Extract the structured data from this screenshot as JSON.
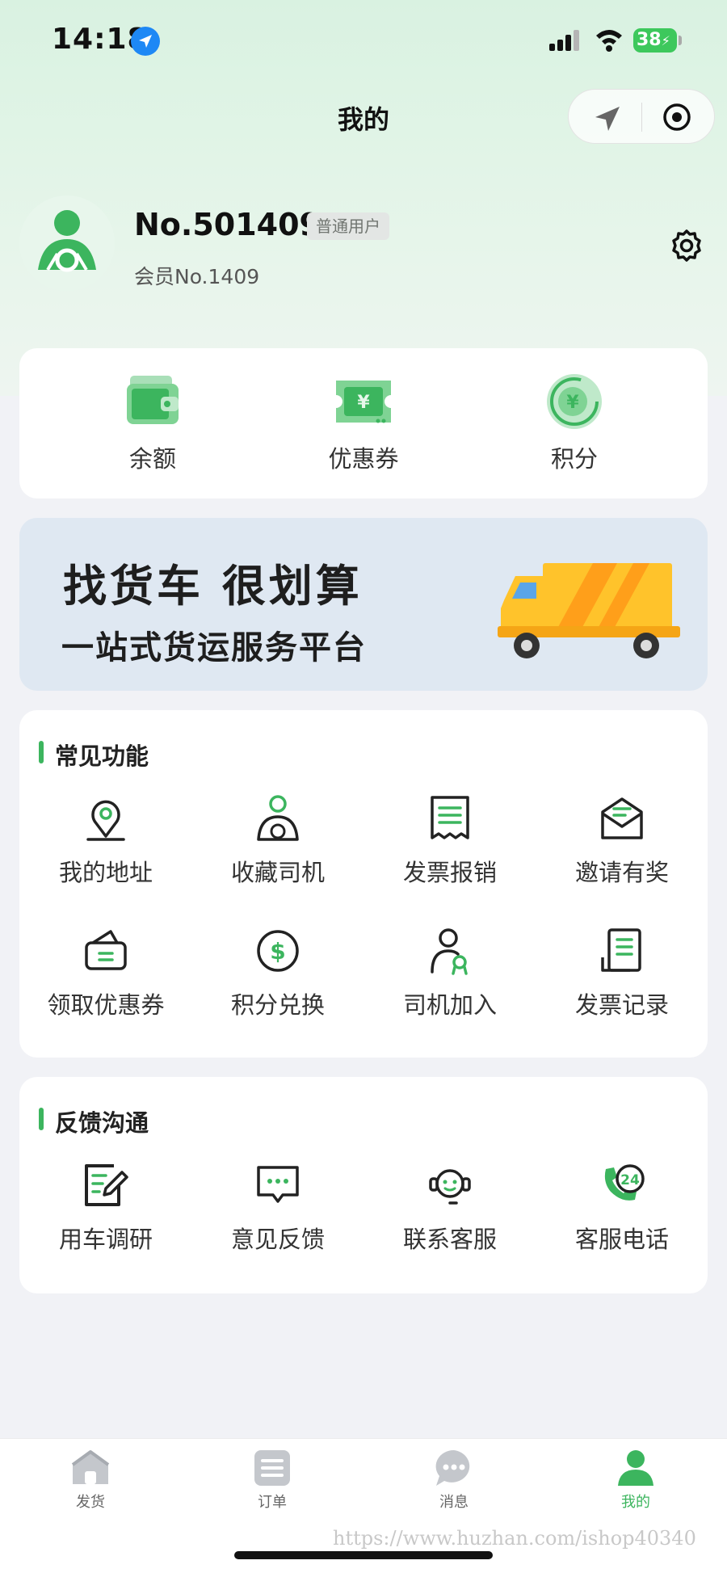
{
  "status_bar": {
    "time": "14:18",
    "battery": "38",
    "icons": [
      "location-arrow-icon",
      "signal-icon",
      "wifi-icon",
      "battery-icon"
    ]
  },
  "nav": {
    "title": "我的",
    "capsule_icons": [
      "navigation-arrow-icon",
      "target-icon"
    ]
  },
  "profile": {
    "name": "No.501409",
    "badge": "普通用户",
    "member_no": "会员No.1409",
    "settings_icon": "gear-icon"
  },
  "wallet": {
    "items": [
      {
        "label": "余额",
        "icon": "wallet-icon"
      },
      {
        "label": "优惠券",
        "icon": "coupon-icon"
      },
      {
        "label": "积分",
        "icon": "points-icon"
      }
    ]
  },
  "banner": {
    "title": "找货车 很划算",
    "subtitle": "一站式货运服务平台",
    "image": "truck-illustration"
  },
  "common": {
    "title": "常见功能",
    "items": [
      {
        "label": "我的地址",
        "icon": "address-pin-icon"
      },
      {
        "label": "收藏司机",
        "icon": "driver-icon"
      },
      {
        "label": "发票报销",
        "icon": "invoice-icon"
      },
      {
        "label": "邀请有奖",
        "icon": "invite-envelope-icon"
      },
      {
        "label": "领取优惠券",
        "icon": "coupon-wallet-icon"
      },
      {
        "label": "积分兑换",
        "icon": "dollar-coin-icon"
      },
      {
        "label": "司机加入",
        "icon": "driver-join-icon"
      },
      {
        "label": "发票记录",
        "icon": "invoice-record-icon"
      }
    ]
  },
  "feedback": {
    "title": "反馈沟通",
    "items": [
      {
        "label": "用车调研",
        "icon": "survey-edit-icon"
      },
      {
        "label": "意见反馈",
        "icon": "chat-bubble-icon"
      },
      {
        "label": "联系客服",
        "icon": "headset-icon"
      },
      {
        "label": "客服电话",
        "icon": "phone-24-icon"
      }
    ]
  },
  "tabbar": {
    "tabs": [
      {
        "label": "发货",
        "icon": "house-icon",
        "active": false
      },
      {
        "label": "订单",
        "icon": "list-icon",
        "active": false
      },
      {
        "label": "消息",
        "icon": "message-icon",
        "active": false
      },
      {
        "label": "我的",
        "icon": "person-icon",
        "active": true
      }
    ],
    "active_color": "#3cb55e"
  },
  "watermark": "https://www.huzhan.com/ishop40340",
  "colors": {
    "brand_green": "#3cb55e",
    "banner_bg": "#dfe8f2",
    "header_bg": "#d9f2e1"
  }
}
